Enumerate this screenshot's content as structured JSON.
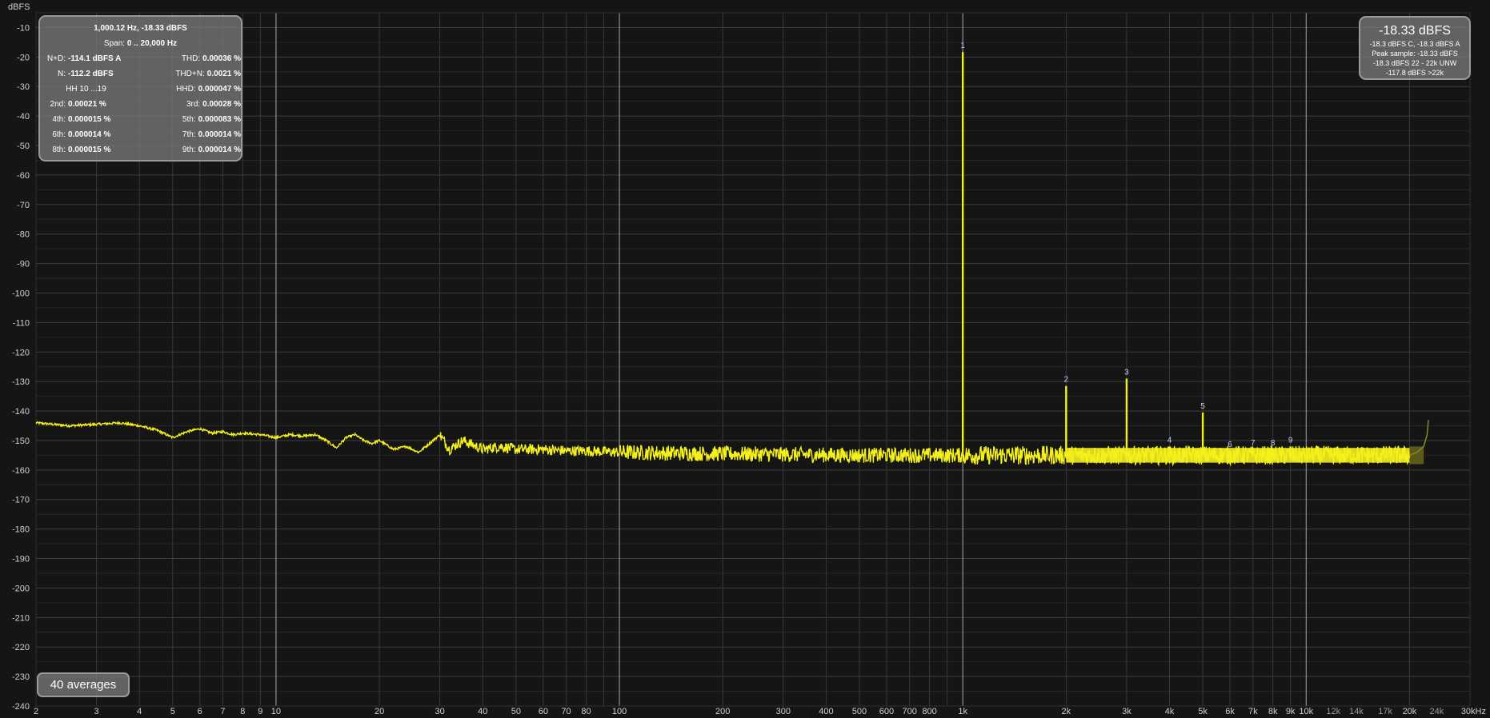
{
  "y_axis_unit": "dBFS",
  "stats_panel": {
    "title": "1,000.12 Hz, -18.33 dBFS",
    "span_label": "Span:",
    "span_value": "0 .. 20,000 Hz",
    "rows": [
      {
        "left_label": "N+D:",
        "left_value": "-114.1 dBFS A",
        "right_label": "THD:",
        "right_value": "0.00036 %"
      },
      {
        "left_label": "N:",
        "left_value": "-112.2 dBFS",
        "right_label": "THD+N:",
        "right_value": "0.0021 %"
      },
      {
        "left_label": "HH 10 ...19",
        "left_value": "",
        "right_label": "HHD:",
        "right_value": "0.000047 %"
      },
      {
        "left_label": "2nd:",
        "left_value": "0.00021 %",
        "right_label": "3rd:",
        "right_value": "0.00028 %"
      },
      {
        "left_label": "4th:",
        "left_value": "0.000015 %",
        "right_label": "5th:",
        "right_value": "0.000083 %"
      },
      {
        "left_label": "6th:",
        "left_value": "0.000014 %",
        "right_label": "7th:",
        "right_value": "0.000014 %"
      },
      {
        "left_label": "8th:",
        "left_value": "0.000015 %",
        "right_label": "9th:",
        "right_value": "0.000014 %"
      }
    ]
  },
  "level_panel": {
    "main": "-18.33 dBFS",
    "lines": [
      "-18.3 dBFS C, -18.3 dBFS A",
      "Peak sample: -18.33 dBFS",
      "-18.3 dBFS 22 - 22k UNW",
      "-117.8 dBFS >22k"
    ]
  },
  "averages_label": "40 averages",
  "chart_data": {
    "type": "line",
    "x_scale": "log",
    "xlim": [
      2,
      30000
    ],
    "ylim": [
      -240,
      -5
    ],
    "grid": true,
    "series_color": "#f4f01c",
    "y_ticks": [
      -10,
      -20,
      -30,
      -40,
      -50,
      -60,
      -70,
      -80,
      -90,
      -100,
      -110,
      -120,
      -130,
      -140,
      -150,
      -160,
      -170,
      -180,
      -190,
      -200,
      -210,
      -220,
      -230,
      -240
    ],
    "x_ticks": [
      {
        "v": 2,
        "label": "2"
      },
      {
        "v": 3,
        "label": "3"
      },
      {
        "v": 4,
        "label": "4"
      },
      {
        "v": 5,
        "label": "5"
      },
      {
        "v": 6,
        "label": "6"
      },
      {
        "v": 7,
        "label": "7"
      },
      {
        "v": 8,
        "label": "8"
      },
      {
        "v": 9,
        "label": "9"
      },
      {
        "v": 10,
        "label": "10"
      },
      {
        "v": 20,
        "label": "20"
      },
      {
        "v": 30,
        "label": "30"
      },
      {
        "v": 40,
        "label": "40"
      },
      {
        "v": 50,
        "label": "50"
      },
      {
        "v": 60,
        "label": "60"
      },
      {
        "v": 70,
        "label": "70"
      },
      {
        "v": 80,
        "label": "80"
      },
      {
        "v": 100,
        "label": "100"
      },
      {
        "v": 200,
        "label": "200"
      },
      {
        "v": 300,
        "label": "300"
      },
      {
        "v": 400,
        "label": "400"
      },
      {
        "v": 500,
        "label": "500"
      },
      {
        "v": 600,
        "label": "600"
      },
      {
        "v": 700,
        "label": "700"
      },
      {
        "v": 800,
        "label": "800"
      },
      {
        "v": 1000,
        "label": "1k"
      },
      {
        "v": 2000,
        "label": "2k"
      },
      {
        "v": 3000,
        "label": "3k"
      },
      {
        "v": 4000,
        "label": "4k"
      },
      {
        "v": 5000,
        "label": "5k"
      },
      {
        "v": 6000,
        "label": "6k"
      },
      {
        "v": 7000,
        "label": "7k"
      },
      {
        "v": 8000,
        "label": "8k"
      },
      {
        "v": 9000,
        "label": "9k"
      },
      {
        "v": 10000,
        "label": "10k"
      },
      {
        "v": 12000,
        "label": "12k"
      },
      {
        "v": 14000,
        "label": "14k"
      },
      {
        "v": 17000,
        "label": "17k"
      },
      {
        "v": 20000,
        "label": "20k"
      },
      {
        "v": 24000,
        "label": "24k"
      },
      {
        "v": 30000,
        "label": "30kHz"
      }
    ],
    "noise_floor": [
      [
        2,
        -144
      ],
      [
        2.5,
        -145
      ],
      [
        3,
        -144.5
      ],
      [
        3.5,
        -144
      ],
      [
        4,
        -145
      ],
      [
        4.5,
        -146.5
      ],
      [
        5,
        -149
      ],
      [
        5.5,
        -147
      ],
      [
        6,
        -146
      ],
      [
        6.5,
        -147.5
      ],
      [
        7,
        -147
      ],
      [
        7.5,
        -148
      ],
      [
        8,
        -147.5
      ],
      [
        9,
        -148
      ],
      [
        10,
        -149
      ],
      [
        11,
        -148
      ],
      [
        12,
        -148.5
      ],
      [
        13,
        -148
      ],
      [
        14,
        -150
      ],
      [
        15,
        -152.5
      ],
      [
        16,
        -149
      ],
      [
        17,
        -148
      ],
      [
        18,
        -150
      ],
      [
        19,
        -151
      ],
      [
        20,
        -150
      ],
      [
        22,
        -153
      ],
      [
        24,
        -152
      ],
      [
        26,
        -154
      ],
      [
        28,
        -151
      ],
      [
        30,
        -148
      ],
      [
        32,
        -153
      ],
      [
        35,
        -150
      ],
      [
        40,
        -153
      ],
      [
        45,
        -152
      ],
      [
        50,
        -153
      ],
      [
        60,
        -153
      ],
      [
        70,
        -153.5
      ],
      [
        80,
        -153.5
      ],
      [
        100,
        -154
      ],
      [
        200,
        -154.5
      ],
      [
        500,
        -155
      ],
      [
        1000,
        -155
      ],
      [
        2000,
        -155
      ],
      [
        5000,
        -155
      ],
      [
        10000,
        -155
      ],
      [
        20000,
        -155
      ]
    ],
    "noise_band_db": [
      -158,
      -152
    ],
    "shaded_region_x": [
      20000,
      22000
    ],
    "rising_tail": [
      [
        20000,
        -155
      ],
      [
        21000,
        -154
      ],
      [
        22000,
        -152
      ],
      [
        22500,
        -148
      ],
      [
        22700,
        -143
      ]
    ],
    "harmonics": [
      {
        "n": "1",
        "freq": 1000,
        "db": -18.3
      },
      {
        "n": "2",
        "freq": 2000,
        "db": -131.5
      },
      {
        "n": "3",
        "freq": 3000,
        "db": -129
      },
      {
        "n": "4",
        "freq": 4000,
        "db": -152
      },
      {
        "n": "5",
        "freq": 5000,
        "db": -140.5
      },
      {
        "n": "6",
        "freq": 6000,
        "db": -153.5
      },
      {
        "n": "7",
        "freq": 7000,
        "db": -153
      },
      {
        "n": "8",
        "freq": 8000,
        "db": -153
      },
      {
        "n": "9",
        "freq": 9000,
        "db": -152
      }
    ]
  }
}
